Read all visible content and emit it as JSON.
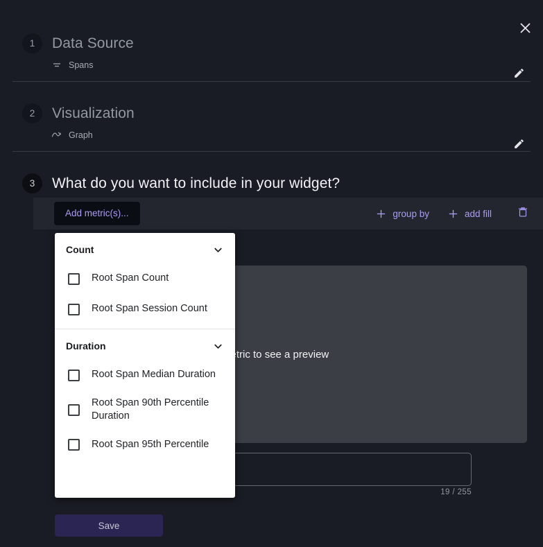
{
  "window": {
    "close_label": "×"
  },
  "steps": [
    {
      "number": "1",
      "title": "Data Source",
      "sub_value": "Spans",
      "sub_icon": "spans-icon",
      "edit_icon": "pencil-icon"
    },
    {
      "number": "2",
      "title": "Visualization",
      "sub_value": "Graph",
      "sub_icon": "graph-icon",
      "edit_icon": "pencil-icon"
    },
    {
      "number": "3",
      "title": "What do you want to include in your widget?"
    }
  ],
  "metric_row": {
    "add_metric_label": "Add metric(s)...",
    "group_by_label": "group by",
    "add_fill_label": "add fill",
    "delete_icon": "trash-icon",
    "accent_color": "#a99df5"
  },
  "preview": {
    "text": "Pick a metric to see a preview"
  },
  "note": {
    "value": "",
    "placeholder": "",
    "counter": "19 / 255"
  },
  "footer": {
    "save_label": "Save"
  },
  "dropdown": {
    "groups": [
      {
        "name": "Count",
        "chevron": "chevron-down-icon",
        "items": [
          {
            "label": "Root Span Count",
            "checked": false
          },
          {
            "label": "Root Span Session Count",
            "checked": false
          }
        ]
      },
      {
        "name": "Duration",
        "chevron": "chevron-down-icon",
        "items": [
          {
            "label": "Root Span Median Duration",
            "checked": false
          },
          {
            "label": "Root Span 90th Percentile Duration",
            "checked": false
          },
          {
            "label": "Root Span 95th Percentile",
            "checked": false
          }
        ]
      }
    ]
  }
}
